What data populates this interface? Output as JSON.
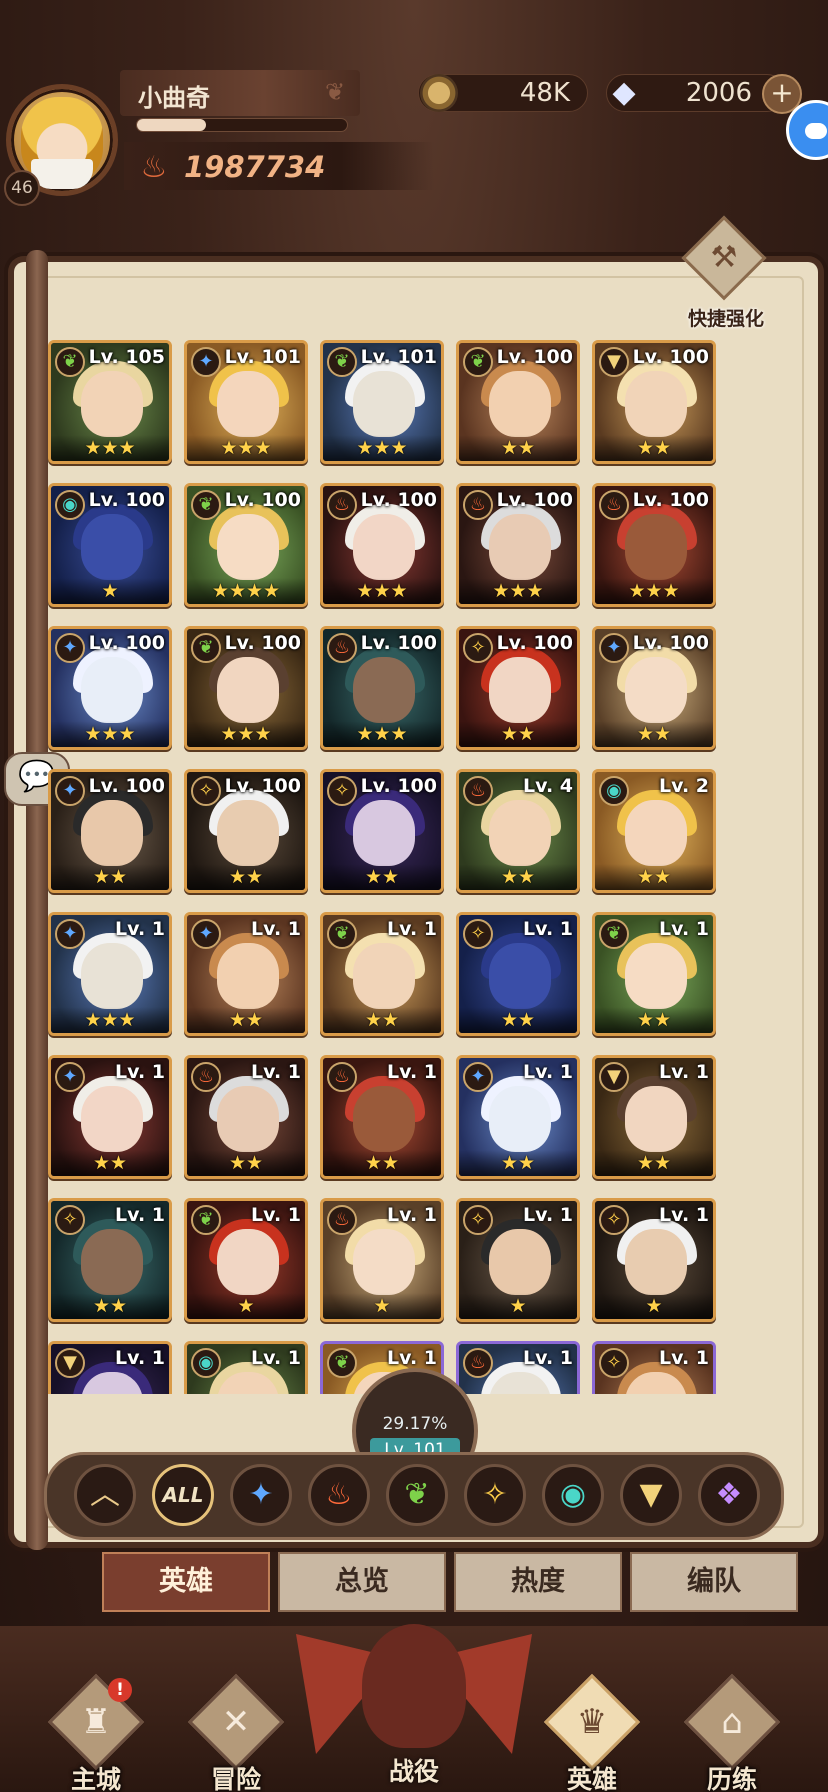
{
  "player": {
    "name": "小曲奇",
    "level": "46",
    "power": "1987734",
    "xp_fraction": 0.33
  },
  "resources": {
    "gold": "48K",
    "gems": "2006",
    "plus": "+"
  },
  "quick_enhance": {
    "label": "快捷强化"
  },
  "heroes": [
    {
      "level": "Lv. 105",
      "stars": "★★★",
      "element": "nature"
    },
    {
      "level": "Lv. 101",
      "stars": "★★★",
      "element": "ice"
    },
    {
      "level": "Lv. 101",
      "stars": "★★★",
      "element": "nature"
    },
    {
      "level": "Lv. 100",
      "stars": "★★",
      "element": "nature"
    },
    {
      "level": "Lv. 100",
      "stars": "★★",
      "element": "light"
    },
    {
      "level": "Lv. 100",
      "stars": "★",
      "element": "eye"
    },
    {
      "level": "Lv. 100",
      "stars": "★★★★",
      "element": "nature"
    },
    {
      "level": "Lv. 100",
      "stars": "★★★",
      "element": "fire"
    },
    {
      "level": "Lv. 100",
      "stars": "★★★",
      "element": "fire"
    },
    {
      "level": "Lv. 100",
      "stars": "★★★",
      "element": "fire"
    },
    {
      "level": "Lv. 100",
      "stars": "★★★",
      "element": "ice"
    },
    {
      "level": "Lv. 100",
      "stars": "★★★",
      "element": "nature"
    },
    {
      "level": "Lv. 100",
      "stars": "★★★",
      "element": "fire"
    },
    {
      "level": "Lv. 100",
      "stars": "★★",
      "element": "star"
    },
    {
      "level": "Lv. 100",
      "stars": "★★",
      "element": "ice"
    },
    {
      "level": "Lv. 100",
      "stars": "★★",
      "element": "ice"
    },
    {
      "level": "Lv. 100",
      "stars": "★★",
      "element": "star"
    },
    {
      "level": "Lv. 100",
      "stars": "★★",
      "element": "star"
    },
    {
      "level": "Lv. 4",
      "stars": "★★",
      "element": "fire"
    },
    {
      "level": "Lv. 2",
      "stars": "★★",
      "element": "eye"
    },
    {
      "level": "Lv. 1",
      "stars": "★★★",
      "element": "ice"
    },
    {
      "level": "Lv. 1",
      "stars": "★★",
      "element": "ice"
    },
    {
      "level": "Lv. 1",
      "stars": "★★",
      "element": "nature"
    },
    {
      "level": "Lv. 1",
      "stars": "★★",
      "element": "star"
    },
    {
      "level": "Lv. 1",
      "stars": "★★",
      "element": "nature"
    },
    {
      "level": "Lv. 1",
      "stars": "★★",
      "element": "ice"
    },
    {
      "level": "Lv. 1",
      "stars": "★★",
      "element": "fire"
    },
    {
      "level": "Lv. 1",
      "stars": "★★",
      "element": "fire"
    },
    {
      "level": "Lv. 1",
      "stars": "★★",
      "element": "ice"
    },
    {
      "level": "Lv. 1",
      "stars": "★★",
      "element": "light"
    },
    {
      "level": "Lv. 1",
      "stars": "★★",
      "element": "star"
    },
    {
      "level": "Lv. 1",
      "stars": "★",
      "element": "nature"
    },
    {
      "level": "Lv. 1",
      "stars": "★",
      "element": "fire"
    },
    {
      "level": "Lv. 1",
      "stars": "★",
      "element": "star"
    },
    {
      "level": "Lv. 1",
      "stars": "★",
      "element": "star"
    },
    {
      "level": "Lv. 1",
      "stars": "",
      "element": "light"
    },
    {
      "level": "Lv. 1",
      "stars": "",
      "element": "eye"
    },
    {
      "level": "Lv. 1",
      "stars": "",
      "element": "nature"
    },
    {
      "level": "Lv. 1",
      "stars": "",
      "element": "fire"
    },
    {
      "level": "Lv. 1",
      "stars": "",
      "element": "star"
    }
  ],
  "progress": {
    "percent": "29.17%",
    "level": "Lv. 101"
  },
  "filters": [
    {
      "id": "collapse",
      "glyph": "︿"
    },
    {
      "id": "all",
      "glyph": "ALL"
    },
    {
      "id": "ice",
      "glyph": "✦"
    },
    {
      "id": "fire",
      "glyph": "♨"
    },
    {
      "id": "nature",
      "glyph": "❦"
    },
    {
      "id": "star",
      "glyph": "✧"
    },
    {
      "id": "eye",
      "glyph": "◉"
    },
    {
      "id": "light",
      "glyph": "▼"
    },
    {
      "id": "void",
      "glyph": "❖"
    }
  ],
  "tabs": [
    "英雄",
    "总览",
    "热度",
    "编队"
  ],
  "nav": [
    {
      "label": "主城",
      "glyph": "♜",
      "badge": "!"
    },
    {
      "label": "冒险",
      "glyph": "✕",
      "badge": ""
    },
    {
      "label": "战役",
      "glyph": "",
      "badge": ""
    },
    {
      "label": "英雄",
      "glyph": "♛",
      "badge": ""
    },
    {
      "label": "历练",
      "glyph": "⌂",
      "badge": ""
    }
  ],
  "colors": {
    "ice": "#5fa8ff",
    "fire": "#ff6a3a",
    "nature": "#7ed24a",
    "star": "#ffcf4a",
    "eye": "#4ad6c8",
    "light": "#f2d27a",
    "void": "#c58cff"
  }
}
